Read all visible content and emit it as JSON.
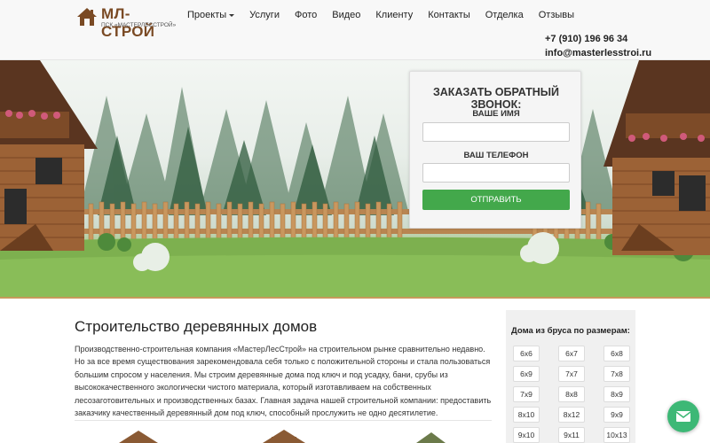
{
  "logo": {
    "title": "МЛ-СТРОЙ",
    "subtitle": "ПСК «МАСТЕРЛЕССТРОЙ»",
    "icon": "house-logo-icon"
  },
  "nav": {
    "items": [
      {
        "label": "Проекты",
        "has_dropdown": true
      },
      {
        "label": "Услуги"
      },
      {
        "label": "Фото"
      },
      {
        "label": "Видео"
      },
      {
        "label": "Клиенту"
      },
      {
        "label": "Контакты"
      },
      {
        "label": "Отделка"
      },
      {
        "label": "Отзывы"
      }
    ]
  },
  "contacts": {
    "phone": "+7 (910) 196 96 34",
    "email": "info@masterlesstroi.ru"
  },
  "callback_form": {
    "title": "ЗАКАЗАТЬ ОБРАТНЫЙ ЗВОНОК:",
    "name_label": "ВАШЕ ИМЯ",
    "phone_label": "ВАШ ТЕЛЕФОН",
    "name_value": "",
    "phone_value": "",
    "submit_label": "ОТПРАВИТЬ"
  },
  "main": {
    "title": "Строительство деревянных домов",
    "text": "Производственно-строительная компания «МастерЛесСтрой» на строительном рынке сравнительно недавно. Но за все время существования зарекомендовала себя только с положительной стороны и стала пользоваться большим спросом у населения. Мы строим деревянные дома под ключ и под усадку, бани, срубы из высококачественного экологически чистого материала, который изготавливаем на собственных лесозаготовительных и производственных базах. Главная задача нашей строительной компании: предоставить заказчику качественный деревянный дом под ключ, способный прослужить не одно десятилетие."
  },
  "sidebar": {
    "title": "Дома из бруса по размерам:",
    "sizes": [
      "6x6",
      "6x7",
      "6x8",
      "6x9",
      "7x7",
      "7x8",
      "7x9",
      "8x8",
      "8x9",
      "8x10",
      "8x12",
      "9x9",
      "9x10",
      "9x11",
      "10x13"
    ]
  },
  "chat": {
    "icon": "mail-icon"
  },
  "colors": {
    "brand_brown": "#7a4a24",
    "button_green": "#43a84b",
    "chat_green": "#3db876"
  }
}
